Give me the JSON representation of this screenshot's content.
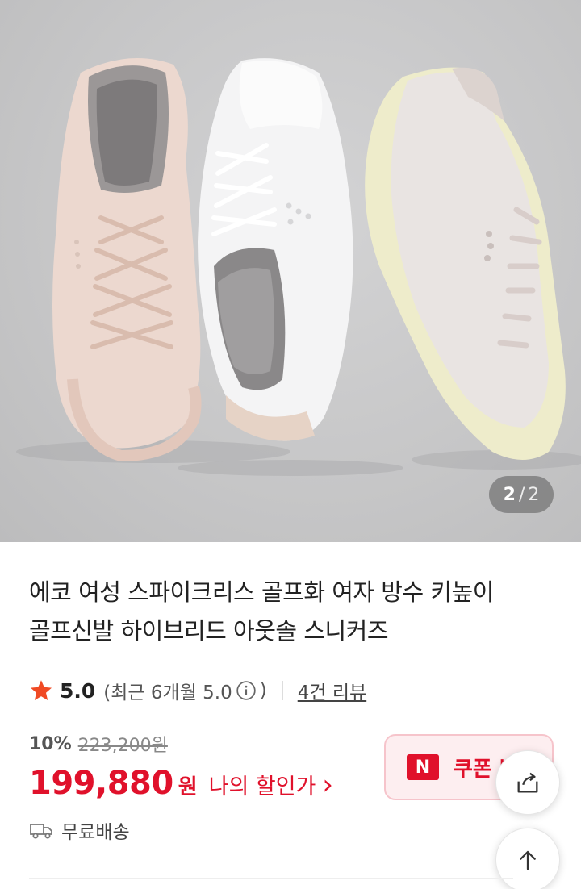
{
  "gallery": {
    "current": "2",
    "separator": "/",
    "total": "2"
  },
  "product": {
    "title_line1": "에코 여성 스파이크리스 골프화 여자 방수 키높이",
    "title_line2": "골프신발 하이브리드 아웃솔 스니커즈"
  },
  "rating": {
    "score": "5.0",
    "recent_prefix": "(최근 6개월 5.0",
    "recent_suffix": ")",
    "reviews": "4건 리뷰"
  },
  "price": {
    "discount_rate": "10%",
    "original": "223,200원",
    "sale": "199,880",
    "unit": "원",
    "my_discount": "나의 할인가",
    "my_discount_arrow": "›"
  },
  "coupon": {
    "logo": "N",
    "label": "쿠폰 받기"
  },
  "shipping": {
    "label": "무료배송"
  },
  "colors": {
    "accent": "#e0112b",
    "star": "#f04a24"
  },
  "icons": {
    "star": "star-icon",
    "info": "info-icon",
    "truck": "truck-icon",
    "share": "share-icon",
    "arrow_up": "arrow-up-icon"
  }
}
